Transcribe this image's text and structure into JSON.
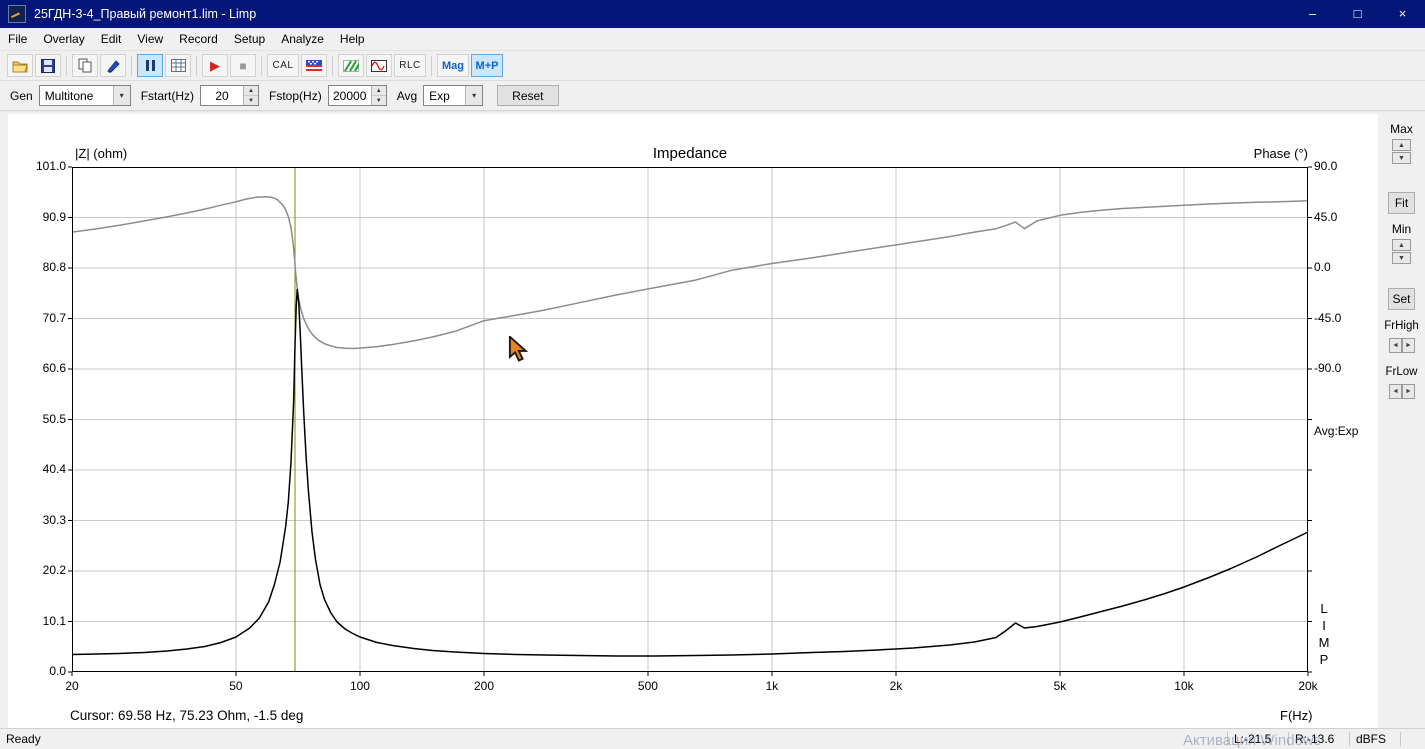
{
  "window": {
    "title": "25ГДН-3-4_Правый ремонт1.lim - Limp",
    "controls": {
      "minimize": "–",
      "maximize": "□",
      "close": "×"
    }
  },
  "menu": {
    "items": [
      "File",
      "Overlay",
      "Edit",
      "View",
      "Record",
      "Setup",
      "Analyze",
      "Help"
    ]
  },
  "toolbar": {
    "cal_label": "CAL",
    "rlc_label": "RLC",
    "mag_label": "Mag",
    "mp_label": "M+P"
  },
  "params": {
    "gen_label": "Gen",
    "gen_value": "Multitone",
    "fstart_label": "Fstart(Hz)",
    "fstart_value": "20",
    "fstop_label": "Fstop(Hz)",
    "fstop_value": "20000",
    "avg_label": "Avg",
    "avg_value": "Exp",
    "reset_label": "Reset"
  },
  "side_panel": {
    "max_label": "Max",
    "fit_label": "Fit",
    "min_label": "Min",
    "set_label": "Set",
    "frhigh_label": "FrHigh",
    "frlow_label": "FrLow"
  },
  "chart": {
    "cursor_text": "Cursor: 69.58 Hz, 75.23 Ohm, -1.5 deg",
    "avg_text": "Avg:Exp",
    "limp": [
      "L",
      "I",
      "M",
      "P"
    ]
  },
  "chart_data": {
    "type": "line",
    "title": "Impedance",
    "x_axis": {
      "label": "F(Hz)",
      "scale": "log",
      "min": 20,
      "max": 20000,
      "tick_labels": [
        "20",
        "50",
        "100",
        "200",
        "500",
        "1k",
        "2k",
        "5k",
        "10k",
        "20k"
      ],
      "tick_values": [
        20,
        50,
        100,
        200,
        500,
        1000,
        2000,
        5000,
        10000,
        20000
      ]
    },
    "y_left": {
      "label": "|Z| (ohm)",
      "min": 0,
      "max": 101,
      "tick_labels": [
        "101.0",
        "90.9",
        "80.8",
        "70.7",
        "60.6",
        "50.5",
        "40.4",
        "30.3",
        "20.2",
        "10.1",
        "0.0"
      ]
    },
    "y_right": {
      "label": "Phase (°)",
      "tick_labels": [
        "90.0",
        "45.0",
        "0.0",
        "-45.0",
        "-90.0"
      ],
      "zero_grid_offset": 2,
      "deg_per_grid": 45
    },
    "cursor": {
      "freq": 69.58,
      "impedance_ohm": 75.23,
      "phase_deg": -1.5,
      "color": "#8a8a00"
    },
    "grid_color": "#c9c9c9",
    "legend_position": "none",
    "series": [
      {
        "name": "phase",
        "axis": "right",
        "color": "#8c8c8c",
        "points": [
          [
            20,
            32
          ],
          [
            23,
            35
          ],
          [
            26,
            38
          ],
          [
            30,
            42
          ],
          [
            34,
            45.5
          ],
          [
            38,
            49
          ],
          [
            42,
            52.5
          ],
          [
            46,
            56
          ],
          [
            50,
            59
          ],
          [
            53,
            61.5
          ],
          [
            56,
            63
          ],
          [
            59,
            63.5
          ],
          [
            61,
            63
          ],
          [
            63,
            61
          ],
          [
            65,
            56
          ],
          [
            66,
            52
          ],
          [
            67,
            46
          ],
          [
            68,
            36
          ],
          [
            68.8,
            22
          ],
          [
            69.4,
            8
          ],
          [
            69.8,
            -4
          ],
          [
            70.4,
            -18
          ],
          [
            71,
            -28
          ],
          [
            72,
            -38
          ],
          [
            73,
            -45
          ],
          [
            74,
            -50
          ],
          [
            75.5,
            -56
          ],
          [
            77,
            -60
          ],
          [
            79,
            -64
          ],
          [
            82,
            -67.5
          ],
          [
            85,
            -69.5
          ],
          [
            88,
            -70.8
          ],
          [
            92,
            -71.5
          ],
          [
            96,
            -71.7
          ],
          [
            100,
            -71.4
          ],
          [
            110,
            -70
          ],
          [
            120,
            -68.2
          ],
          [
            135,
            -65
          ],
          [
            150,
            -61.5
          ],
          [
            170,
            -56.5
          ],
          [
            200,
            -47
          ],
          [
            240,
            -42
          ],
          [
            280,
            -37.5
          ],
          [
            340,
            -31
          ],
          [
            420,
            -24
          ],
          [
            520,
            -17.5
          ],
          [
            650,
            -11
          ],
          [
            800,
            -2
          ],
          [
            1000,
            4
          ],
          [
            1250,
            9
          ],
          [
            1500,
            13.5
          ],
          [
            1800,
            18
          ],
          [
            2200,
            23
          ],
          [
            2700,
            28
          ],
          [
            3100,
            32
          ],
          [
            3500,
            35
          ],
          [
            3700,
            38
          ],
          [
            3900,
            41
          ],
          [
            4100,
            35
          ],
          [
            4400,
            42
          ],
          [
            5000,
            47
          ],
          [
            5600,
            49.5
          ],
          [
            6300,
            51.5
          ],
          [
            7100,
            53
          ],
          [
            8000,
            54
          ],
          [
            9000,
            55
          ],
          [
            10000,
            56
          ],
          [
            11500,
            57
          ],
          [
            13000,
            57.8
          ],
          [
            15000,
            58.5
          ],
          [
            17000,
            59
          ],
          [
            19000,
            59.6
          ],
          [
            20000,
            60
          ]
        ]
      },
      {
        "name": "impedance",
        "axis": "left",
        "color": "#000000",
        "points": [
          [
            20,
            3.5
          ],
          [
            23,
            3.6
          ],
          [
            26,
            3.7
          ],
          [
            30,
            3.9
          ],
          [
            34,
            4.2
          ],
          [
            38,
            4.6
          ],
          [
            42,
            5.1
          ],
          [
            46,
            5.9
          ],
          [
            50,
            7.0
          ],
          [
            54,
            8.8
          ],
          [
            57,
            10.8
          ],
          [
            60,
            14
          ],
          [
            62,
            17.5
          ],
          [
            64,
            22
          ],
          [
            66,
            29
          ],
          [
            67,
            34
          ],
          [
            68,
            42
          ],
          [
            69,
            54
          ],
          [
            69.6,
            66
          ],
          [
            70,
            73
          ],
          [
            70.4,
            76.5
          ],
          [
            71,
            74
          ],
          [
            71.6,
            68
          ],
          [
            72.3,
            60
          ],
          [
            73,
            52
          ],
          [
            74,
            43
          ],
          [
            75,
            36
          ],
          [
            76.5,
            28
          ],
          [
            78,
            22.5
          ],
          [
            80,
            17.5
          ],
          [
            82,
            14.5
          ],
          [
            85,
            11.8
          ],
          [
            88,
            10
          ],
          [
            92,
            8.6
          ],
          [
            96,
            7.7
          ],
          [
            100,
            7.0
          ],
          [
            110,
            5.9
          ],
          [
            120,
            5.3
          ],
          [
            135,
            4.7
          ],
          [
            150,
            4.3
          ],
          [
            170,
            4.0
          ],
          [
            200,
            3.7
          ],
          [
            240,
            3.5
          ],
          [
            280,
            3.4
          ],
          [
            340,
            3.3
          ],
          [
            420,
            3.2
          ],
          [
            520,
            3.2
          ],
          [
            650,
            3.3
          ],
          [
            800,
            3.4
          ],
          [
            1000,
            3.6
          ],
          [
            1250,
            3.9
          ],
          [
            1500,
            4.1
          ],
          [
            1800,
            4.4
          ],
          [
            2200,
            4.8
          ],
          [
            2700,
            5.4
          ],
          [
            3100,
            6.0
          ],
          [
            3500,
            6.9
          ],
          [
            3700,
            8.3
          ],
          [
            3900,
            9.8
          ],
          [
            4100,
            8.8
          ],
          [
            4400,
            9.1
          ],
          [
            5000,
            10.0
          ],
          [
            5600,
            11.0
          ],
          [
            6300,
            12.1
          ],
          [
            7100,
            13.2
          ],
          [
            8000,
            14.4
          ],
          [
            9000,
            15.7
          ],
          [
            10000,
            17.0
          ],
          [
            11500,
            18.9
          ],
          [
            13000,
            20.7
          ],
          [
            15000,
            23.0
          ],
          [
            17000,
            25.2
          ],
          [
            19000,
            27.1
          ],
          [
            20000,
            28.0
          ]
        ]
      }
    ]
  },
  "statusbar": {
    "ready": "Ready",
    "left_level": "L:-21.5",
    "right_level": "R:-13.6",
    "unit": "dBFS"
  },
  "watermark": "Активация Windows"
}
